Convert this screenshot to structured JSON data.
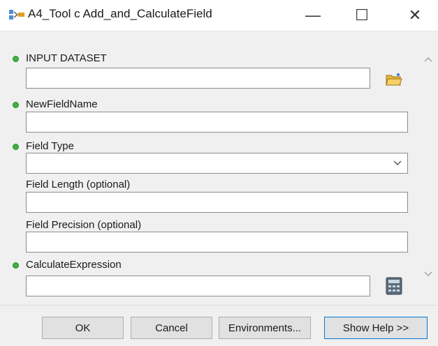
{
  "window": {
    "title": "A4_Tool c Add_and_CalculateField",
    "minimize_glyph": "—",
    "maximize_glyph": "☐",
    "close_glyph": "✕"
  },
  "params": [
    {
      "label": "INPUT DATASET",
      "value": "",
      "required": true
    },
    {
      "label": "NewFieldName",
      "value": "",
      "required": true
    },
    {
      "label": "Field Type",
      "value": "",
      "required": true
    },
    {
      "label": "Field Length (optional)",
      "value": "",
      "required": false
    },
    {
      "label": "Field Precision (optional)",
      "value": "",
      "required": false
    },
    {
      "label": "CalculateExpression",
      "value": "",
      "required": true
    }
  ],
  "buttons": {
    "ok": "OK",
    "cancel": "Cancel",
    "environments": "Environments...",
    "show_help": "Show Help >>"
  },
  "icons": {
    "app": "model-tool-icon",
    "browse": "folder-open-icon",
    "calculator": "calculator-icon",
    "dropdown": "chevron-down-icon",
    "scroll_up": "chevron-up-icon",
    "scroll_down": "chevron-down-icon"
  },
  "colors": {
    "required_dot": "#3fb23f",
    "default_button_border": "#0078d7",
    "dialog_bg": "#f0f0f0"
  }
}
